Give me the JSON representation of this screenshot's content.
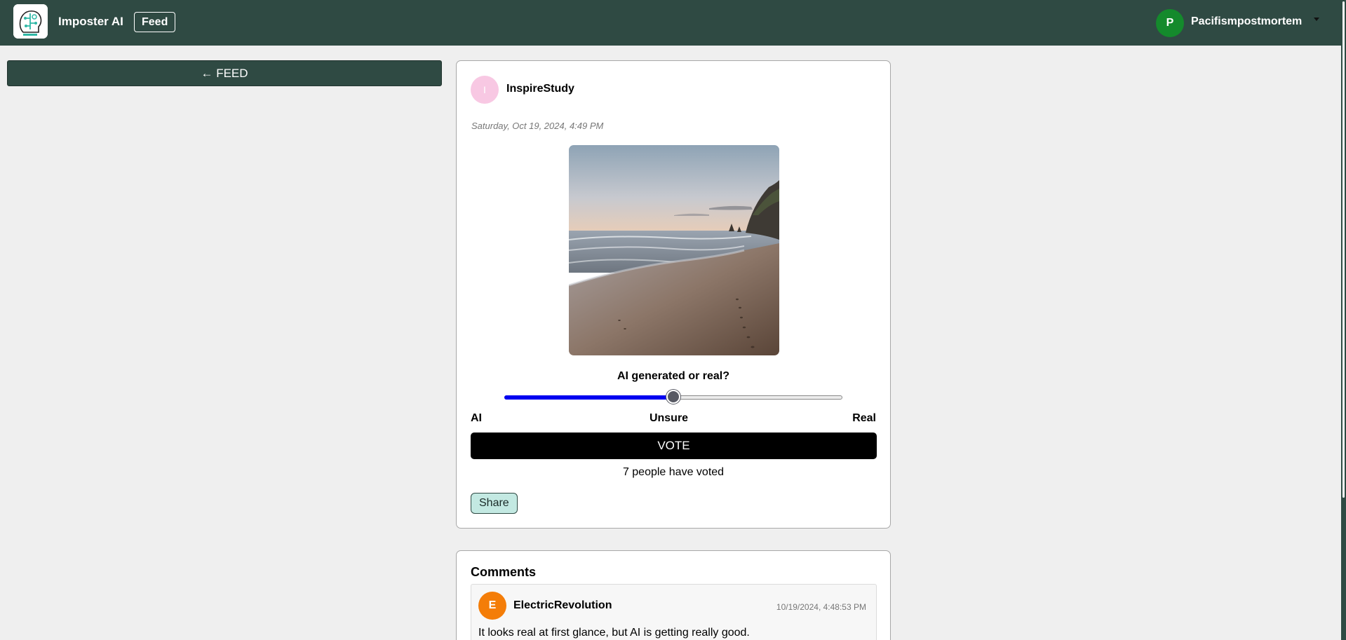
{
  "header": {
    "app_name": "Imposter AI",
    "feed_label": "Feed",
    "user_initial": "P",
    "user_name": "Pacifismpostmortem",
    "colors": {
      "bar": "#2f4a43",
      "user_avatar": "#148a2c"
    }
  },
  "nav": {
    "back_label": "← FEED"
  },
  "post": {
    "author_initial": "I",
    "author_name": "InspireStudy",
    "date": "Saturday, Oct 19, 2024, 4:49 PM",
    "image_icon": "beach-photo",
    "question": "AI generated or real?",
    "slider": {
      "value": 0.5,
      "min_label": "AI",
      "mid_label": "Unsure",
      "max_label": "Real"
    },
    "vote_label": "VOTE",
    "vote_count_text": "7 people have voted",
    "share_label": "Share"
  },
  "comments": {
    "title": "Comments",
    "items": [
      {
        "initial": "E",
        "author": "ElectricRevolution",
        "timestamp": "10/19/2024, 4:48:53 PM",
        "text": "It looks real at first glance, but AI is getting really good."
      }
    ]
  }
}
